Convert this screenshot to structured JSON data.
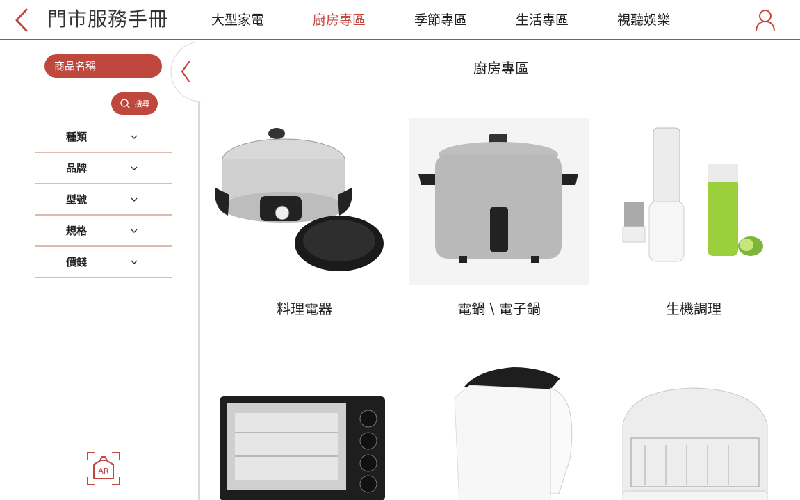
{
  "header": {
    "title": "門市服務手冊",
    "nav": [
      {
        "label": "大型家電",
        "active": false
      },
      {
        "label": "廚房專區",
        "active": true
      },
      {
        "label": "季節專區",
        "active": false
      },
      {
        "label": "生活專區",
        "active": false
      },
      {
        "label": "視聽娛樂",
        "active": false
      }
    ]
  },
  "sidebar": {
    "name_placeholder": "商品名稱",
    "search_label": "搜尋",
    "filters": [
      {
        "label": "種類"
      },
      {
        "label": "品牌"
      },
      {
        "label": "型號"
      },
      {
        "label": "規格"
      },
      {
        "label": "價錢"
      }
    ],
    "ar_label": "AR"
  },
  "main": {
    "title": "廚房專區",
    "categories": [
      {
        "label": "料理電器",
        "icon": "electric-hot-pot-icon"
      },
      {
        "label": "電鍋 \\ 電子鍋",
        "icon": "rice-cooker-icon"
      },
      {
        "label": "生機調理",
        "icon": "blender-icon"
      },
      {
        "label": "",
        "icon": "toaster-oven-icon"
      },
      {
        "label": "",
        "icon": "electric-kettle-icon"
      },
      {
        "label": "",
        "icon": "dish-dryer-icon"
      }
    ]
  },
  "colors": {
    "accent": "#c0473e",
    "divider": "#e2b6b2"
  }
}
